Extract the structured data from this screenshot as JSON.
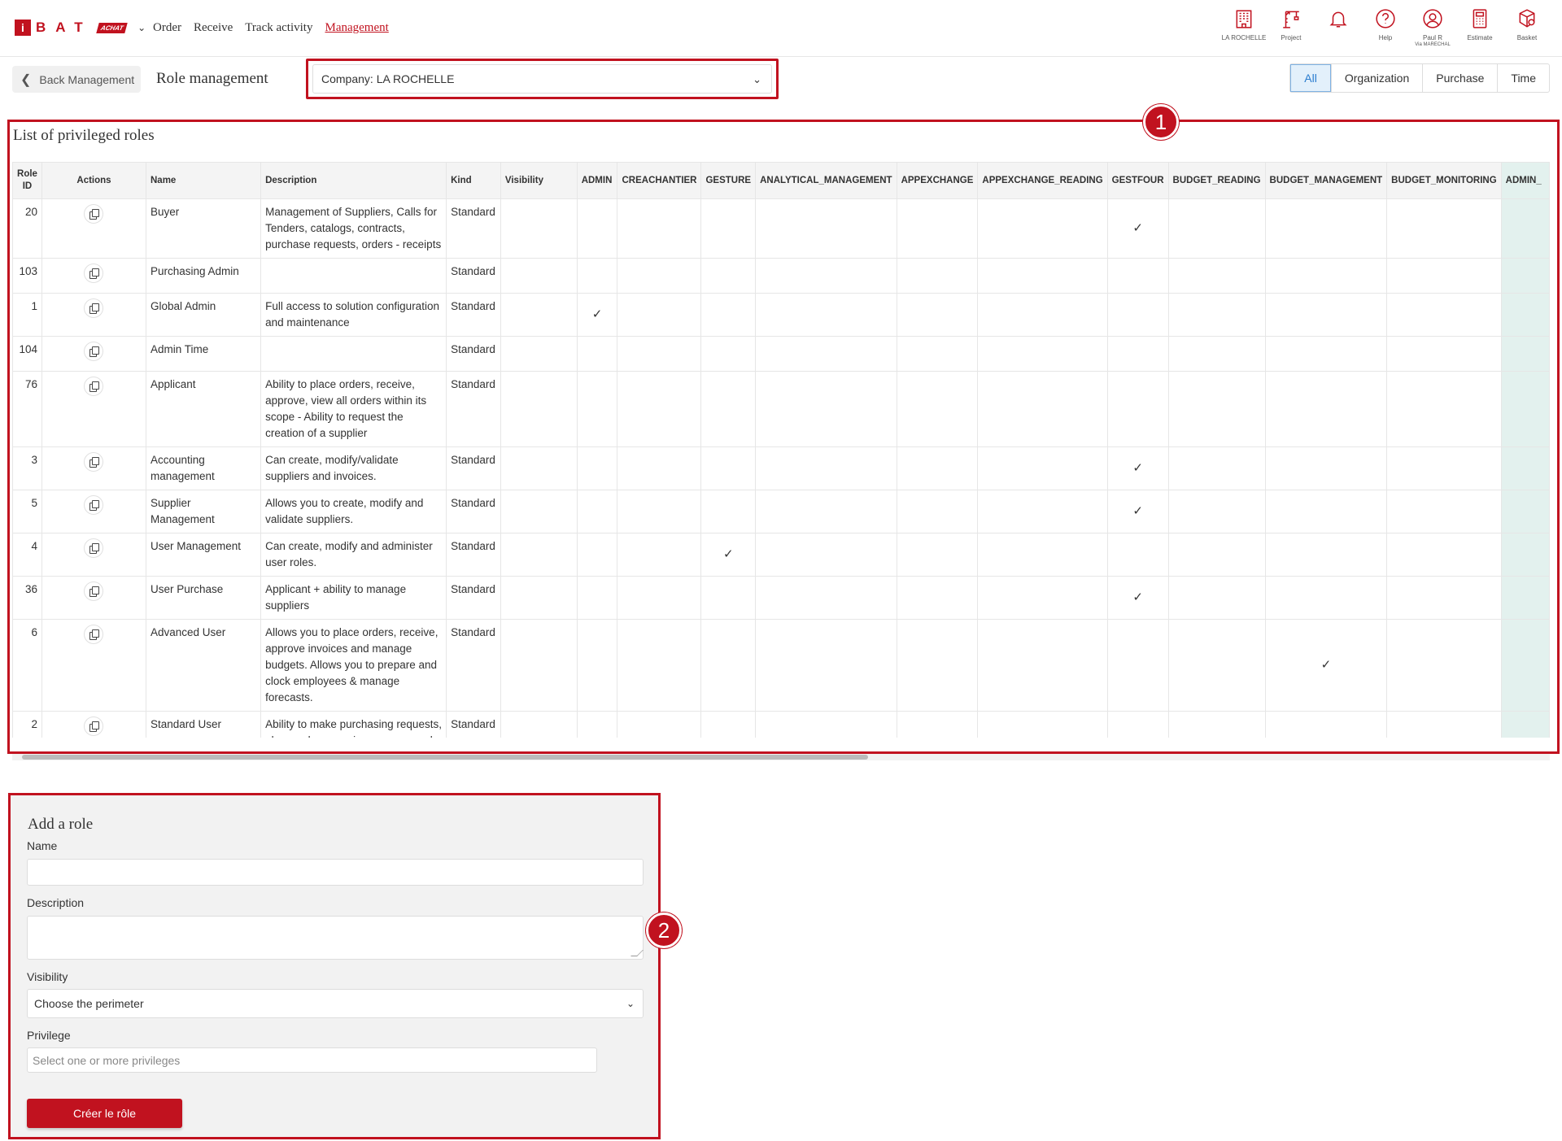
{
  "brand": {
    "mark": "i",
    "name": "BAT",
    "badge": "ACHAT"
  },
  "nav": [
    {
      "label": "Order"
    },
    {
      "label": "Receive"
    },
    {
      "label": "Track activity"
    },
    {
      "label": "Management",
      "active": true
    }
  ],
  "top_icons": [
    {
      "icon": "building-icon",
      "label": "LA ROCHELLE"
    },
    {
      "icon": "crane-icon",
      "label": "Project"
    },
    {
      "icon": "bell-icon",
      "label": ""
    },
    {
      "icon": "help-icon",
      "label": "Help"
    },
    {
      "icon": "user-icon",
      "label": "Paul R",
      "sublabel": "Via MARECHAL"
    },
    {
      "icon": "calculator-icon",
      "label": "Estimate"
    },
    {
      "icon": "basket-icon",
      "label": "Basket"
    }
  ],
  "subbar": {
    "back_label": "Back Management",
    "title": "Role management",
    "company_select": "Company: LA ROCHELLE",
    "filters": [
      {
        "label": "All",
        "active": true
      },
      {
        "label": "Organization"
      },
      {
        "label": "Purchase"
      },
      {
        "label": "Time"
      }
    ]
  },
  "roles_panel": {
    "title": "List of privileged roles",
    "marker": "1",
    "columns": [
      "Role ID",
      "Actions",
      "Name",
      "Description",
      "Kind",
      "Visibility",
      "ADMIN",
      "CREACHANTIER",
      "GESTURE",
      "ANALYTICAL_MANAGEMENT",
      "APPEXCHANGE",
      "APPEXCHANGE_READING",
      "GESTFOUR",
      "BUDGET_READING",
      "BUDGET_MANAGEMENT",
      "BUDGET_MONITORING",
      "ADMIN_"
    ],
    "rows": [
      {
        "id": "20",
        "name": "Buyer",
        "description": "Management of Suppliers, Calls for Tenders, catalogs, contracts, purchase requests, orders - receipts",
        "kind": "Standard",
        "visibility": "",
        "checks": [
          "GESTFOUR"
        ]
      },
      {
        "id": "103",
        "name": "Purchasing Admin",
        "description": "",
        "kind": "Standard",
        "visibility": "",
        "checks": []
      },
      {
        "id": "1",
        "name": "Global Admin",
        "description": "Full access to solution configuration and maintenance",
        "kind": "Standard",
        "visibility": "",
        "checks": [
          "ADMIN"
        ]
      },
      {
        "id": "104",
        "name": "Admin Time",
        "description": "",
        "kind": "Standard",
        "visibility": "",
        "checks": []
      },
      {
        "id": "76",
        "name": "Applicant",
        "description": "Ability to place orders, receive, approve, view all orders within its scope - Ability to request the creation of a supplier",
        "kind": "Standard",
        "visibility": "",
        "checks": []
      },
      {
        "id": "3",
        "name": "Accounting management",
        "description": "Can create, modify/validate suppliers and invoices.",
        "kind": "Standard",
        "visibility": "",
        "checks": [
          "GESTFOUR"
        ]
      },
      {
        "id": "5",
        "name": "Supplier Management",
        "description": "Allows you to create, modify and validate suppliers.",
        "kind": "Standard",
        "visibility": "",
        "checks": [
          "GESTFOUR"
        ]
      },
      {
        "id": "4",
        "name": "User Management",
        "description": "Can create, modify and administer user roles.",
        "kind": "Standard",
        "visibility": "",
        "checks": [
          "GESTURE"
        ]
      },
      {
        "id": "36",
        "name": "User Purchase",
        "description": "Applicant + ability to manage suppliers",
        "kind": "Standard",
        "visibility": "",
        "checks": [
          "GESTFOUR"
        ]
      },
      {
        "id": "6",
        "name": "Advanced User",
        "description": "Allows you to place orders, receive, approve invoices and manage budgets. Allows you to prepare and clock employees & manage forecasts.",
        "kind": "Standard",
        "visibility": "",
        "checks": [
          "BUDGET_MANAGEMENT"
        ]
      },
      {
        "id": "2",
        "name": "Standard User",
        "description": "Ability to make purchasing requests, place orders, receive, prepare and clock employees",
        "kind": "Standard",
        "visibility": "",
        "checks": []
      }
    ]
  },
  "add_role": {
    "title": "Add a role",
    "marker": "2",
    "name_label": "Name",
    "name_value": "",
    "description_label": "Description",
    "description_value": "",
    "visibility_label": "Visibility",
    "visibility_value": "Choose the perimeter",
    "privilege_label": "Privilege",
    "privilege_placeholder": "Select one or more privileges",
    "submit_label": "Créer le rôle"
  },
  "colors": {
    "brand": "#c1121f",
    "active_filter": "#2a7ccf",
    "highlight_col": "#e3f1ee"
  }
}
